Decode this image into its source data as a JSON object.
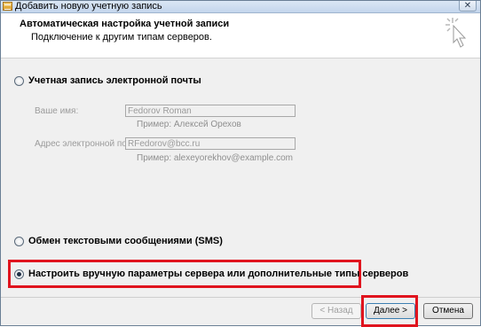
{
  "window": {
    "title": "Добавить новую учетную запись",
    "close_glyph": "✕"
  },
  "header": {
    "title": "Автоматическая настройка учетной записи",
    "subtitle": "Подключение к другим типам серверов."
  },
  "options": {
    "email": {
      "label": "Учетная запись электронной почты",
      "checked": false
    },
    "sms": {
      "label": "Обмен текстовыми сообщениями (SMS)",
      "checked": false
    },
    "manual": {
      "label": "Настроить вручную параметры сервера или дополнительные типы серверов",
      "checked": true
    }
  },
  "form": {
    "name_label": "Ваше имя:",
    "name_value": "Fedorov Roman",
    "name_hint": "Пример: Алексей Орехов",
    "email_label": "Адрес электронной почты:",
    "email_value": "RFedorov@bcc.ru",
    "email_hint": "Пример: alexeyorekhov@example.com"
  },
  "buttons": {
    "back": "< Назад",
    "next": "Далее >",
    "cancel": "Отмена"
  },
  "colors": {
    "highlight": "#e0141e"
  }
}
